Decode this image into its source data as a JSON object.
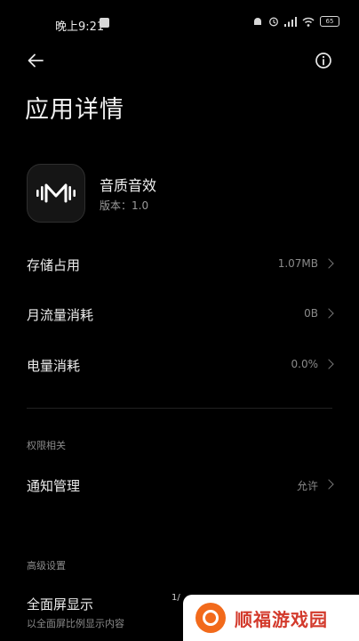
{
  "status_bar": {
    "time": "晚上9:21",
    "battery": "65"
  },
  "header": {
    "title": "应用详情"
  },
  "app": {
    "name": "音质音效",
    "version": "版本：1.0"
  },
  "rows": [
    {
      "label": "存储占用",
      "value": "1.07MB"
    },
    {
      "label": "月流量消耗",
      "value": "0B"
    },
    {
      "label": "电量消耗",
      "value": "0.0%"
    }
  ],
  "permissions": {
    "section_title": "权限相关",
    "notification": {
      "label": "通知管理",
      "value": "允许"
    }
  },
  "advanced": {
    "section_title": "高级设置",
    "fullscreen_label": "全面屏显示",
    "fullscreen_desc": "以全面屏比例显示内容",
    "page_indicator": "1/"
  },
  "watermark": {
    "text": "顺福游戏园"
  },
  "colors": {
    "background": "#000000",
    "watermark_accent": "#d33a2c",
    "watermark_logo": "#f26a1b"
  }
}
